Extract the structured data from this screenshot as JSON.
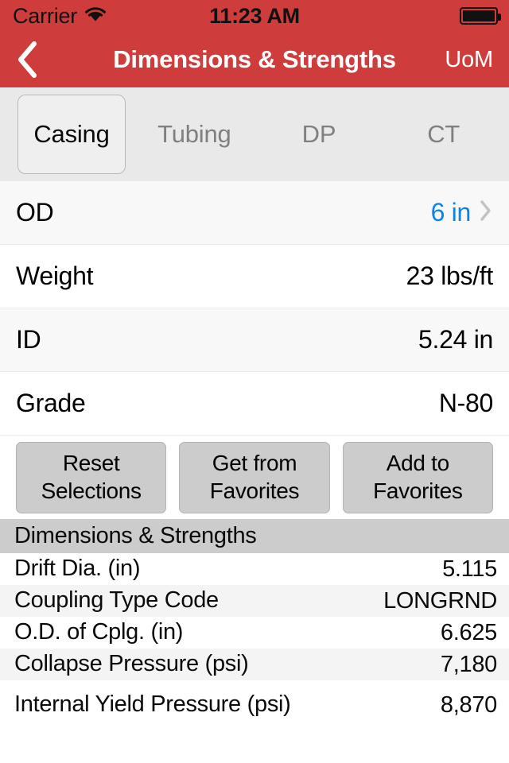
{
  "status_bar": {
    "carrier": "Carrier",
    "wifi_icon": "wifi-icon",
    "time": "11:23 AM",
    "battery_icon": "battery-full-icon"
  },
  "nav_bar": {
    "back_icon": "chevron-left-icon",
    "title": "Dimensions & Strengths",
    "right_action": "UoM",
    "bar_color": "#cf3c3c"
  },
  "tabs": {
    "selected": "Casing",
    "items": [
      {
        "label": "Casing",
        "selected": true
      },
      {
        "label": "Tubing",
        "selected": false
      },
      {
        "label": "DP",
        "selected": false
      },
      {
        "label": "CT",
        "selected": false
      }
    ]
  },
  "properties": [
    {
      "label": "OD",
      "value": "6 in",
      "is_link": true,
      "has_chevron": true
    },
    {
      "label": "Weight",
      "value": "23 lbs/ft",
      "is_link": false,
      "has_chevron": false
    },
    {
      "label": "ID",
      "value": "5.24 in",
      "is_link": false,
      "has_chevron": false
    },
    {
      "label": "Grade",
      "value": "N-80",
      "is_link": false,
      "has_chevron": false
    }
  ],
  "buttons": [
    {
      "line1": "Reset",
      "line2": "Selections"
    },
    {
      "line1": "Get from",
      "line2": "Favorites"
    },
    {
      "line1": "Add to",
      "line2": "Favorites"
    }
  ],
  "detail_section": {
    "header": "Dimensions & Strengths",
    "rows": [
      {
        "label": "Drift Dia. (in)",
        "value": "5.115"
      },
      {
        "label": "Coupling Type Code",
        "value": "LONGRND"
      },
      {
        "label": "O.D. of Cplg. (in)",
        "value": "6.625"
      },
      {
        "label": "Collapse Pressure (psi)",
        "value": "7,180"
      },
      {
        "label": "Internal Yield Pressure (psi)",
        "value": "8,870"
      }
    ]
  },
  "colors": {
    "accent_red": "#cf3c3c",
    "link_blue": "#0b84e8",
    "section_gray": "#cccccc",
    "tabbar_gray": "#e9e9e9"
  }
}
